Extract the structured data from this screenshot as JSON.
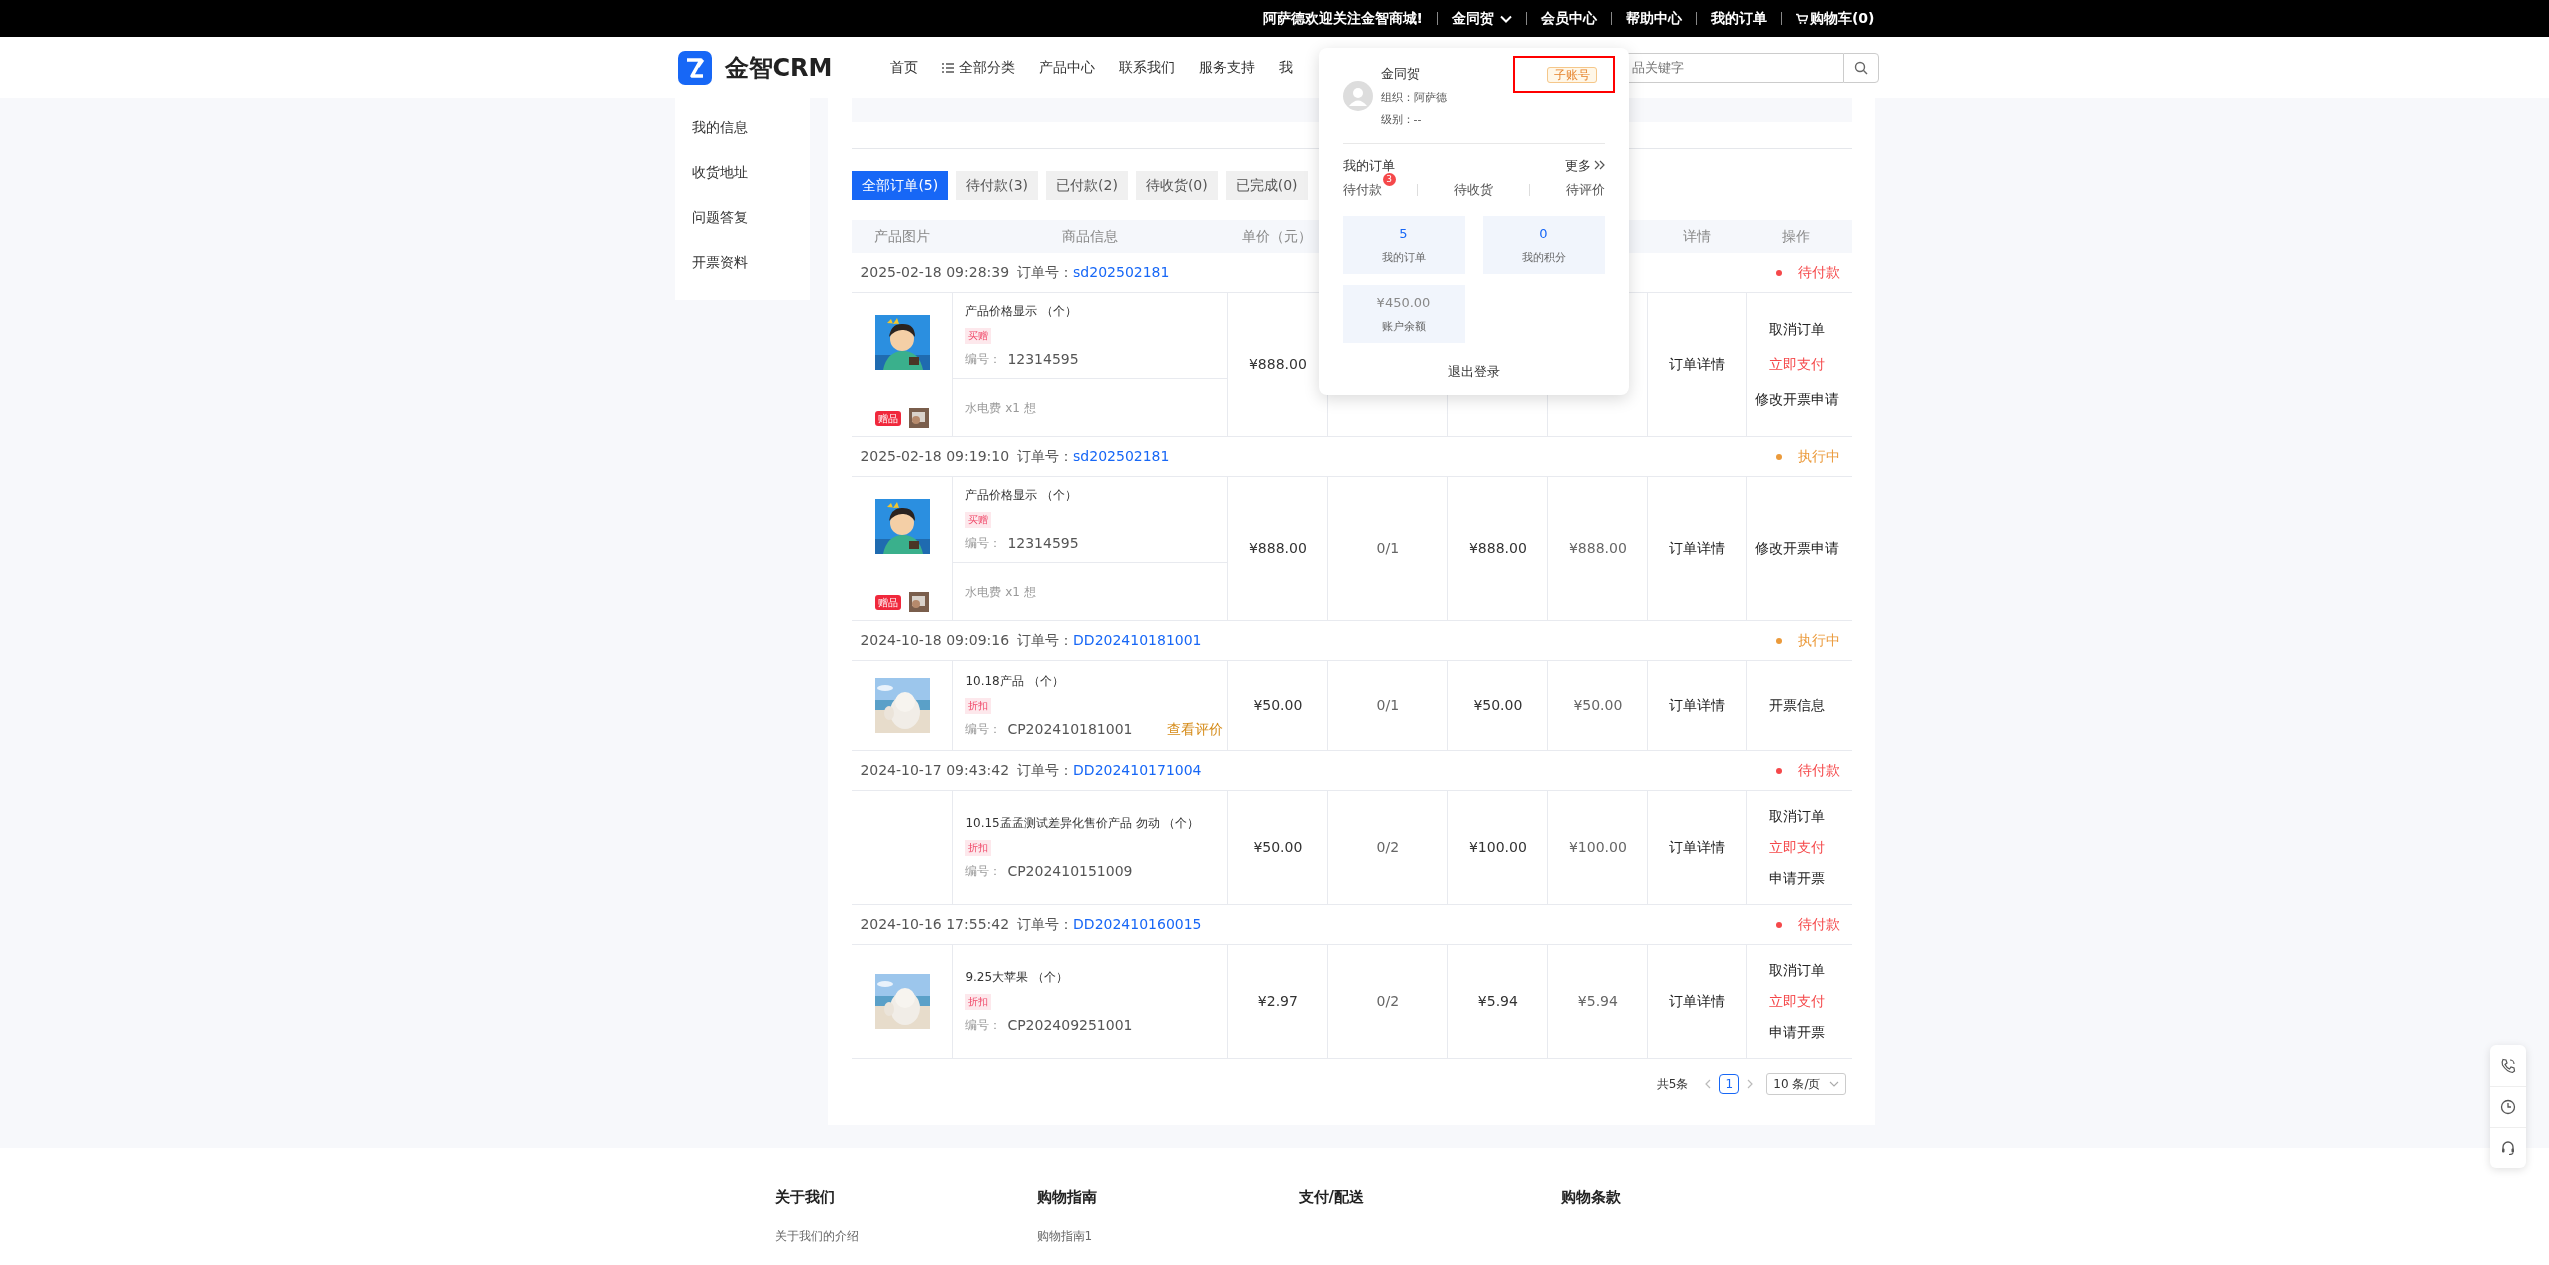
{
  "topbar": {
    "welcome": "阿萨德欢迎关注金智商城!",
    "links": [
      {
        "label": "金同贺",
        "kind": "dropdown"
      },
      {
        "label": "会员中心",
        "kind": "link"
      },
      {
        "label": "帮助中心",
        "kind": "link"
      },
      {
        "label": "我的订单",
        "kind": "link"
      },
      {
        "label": "购物车(0)",
        "kind": "cart"
      }
    ]
  },
  "header": {
    "logo": "金智CRM",
    "nav": [
      {
        "label": "首页",
        "kind": "link"
      },
      {
        "label": "全部分类",
        "kind": "menu"
      },
      {
        "label": "产品中心",
        "kind": "link"
      },
      {
        "label": "联系我们",
        "kind": "link"
      },
      {
        "label": "服务支持",
        "kind": "link"
      },
      {
        "label": "我",
        "kind": "link"
      }
    ],
    "search": {
      "placeholder": "品关键字"
    }
  },
  "user_menu": {
    "name": "金同贺",
    "org": "组织：阿萨德",
    "level": "级别：--",
    "account_tag": "子账号",
    "highlighted": true,
    "orders_title": "我的订单",
    "more": "更多",
    "order_states": [
      {
        "label": "待付款",
        "badge": "3"
      },
      {
        "label": "待收货"
      },
      {
        "label": "待评价"
      }
    ],
    "stats": [
      {
        "value": "5",
        "label": "我的订单",
        "kind": "link"
      },
      {
        "value": "0",
        "label": "我的积分",
        "kind": "link"
      },
      {
        "value": "¥450.00",
        "label": "账户余额",
        "kind": "muted"
      }
    ],
    "logout": "退出登录"
  },
  "sidebar": {
    "items": [
      "我的信息",
      "收货地址",
      "问题答复",
      "开票资料"
    ]
  },
  "tabs": [
    {
      "label": "全部订单(5)",
      "selected": true
    },
    {
      "label": "待付款(3)",
      "selected": false
    },
    {
      "label": "已付款(2)",
      "selected": false
    },
    {
      "label": "待收货(0)",
      "selected": false
    },
    {
      "label": "已完成(0)",
      "selected": false
    }
  ],
  "table": {
    "columns_left": [
      "产品图片",
      "商品信息",
      "单价（元）"
    ],
    "columns_right": [
      "详情",
      "操作"
    ],
    "orders": [
      {
        "time": "2025-02-18 09:28:39",
        "no_label": "订单号：",
        "no": "sd202502181",
        "status": "待付款",
        "color": "#f5484a",
        "has_image": true,
        "name": "产品价格显示 （个）",
        "tag": "买赠",
        "code_label": "编号：",
        "code": "12314595",
        "gift": {
          "badge": "赠品",
          "text": "水电费 x1 想"
        },
        "unit_price": "¥888.00",
        "detail": "订单详情",
        "actions": [
          {
            "label": "取消订单",
            "kind": "normal"
          },
          {
            "label": "立即支付",
            "kind": "danger"
          },
          {
            "label": "修改开票申请",
            "kind": "normal"
          }
        ]
      },
      {
        "time": "2025-02-18 09:19:10",
        "no_label": "订单号：",
        "no": "sd202502181",
        "status": "执行中",
        "color": "#eb9a3b",
        "has_image": true,
        "name": "产品价格显示 （个）",
        "tag": "买赠",
        "code_label": "编号：",
        "code": "12314595",
        "gift": {
          "badge": "赠品",
          "text": "水电费 x1 想"
        },
        "unit_price": "¥888.00",
        "qty": "0/1",
        "amount": "¥888.00",
        "paid": "¥888.00",
        "detail": "订单详情",
        "actions": [
          {
            "label": "修改开票申请",
            "kind": "normal"
          }
        ]
      },
      {
        "time": "2024-10-18 09:09:16",
        "no_label": "订单号：",
        "no": "DD202410181001",
        "status": "执行中",
        "color": "#eb9a3b",
        "has_image": true,
        "name": "10.18产品 （个）",
        "tag": "折扣",
        "code_label": "编号：",
        "code": "CP202410181001",
        "review": "查看评价",
        "unit_price": "¥50.00",
        "qty": "0/1",
        "amount": "¥50.00",
        "paid": "¥50.00",
        "detail": "订单详情",
        "actions": [
          {
            "label": "开票信息",
            "kind": "normal"
          }
        ]
      },
      {
        "time": "2024-10-17 09:43:42",
        "no_label": "订单号：",
        "no": "DD202410171004",
        "status": "待付款",
        "color": "#f5484a",
        "has_image": false,
        "name": "10.15孟孟测试差异化售价产品 勿动 （个）",
        "tag": "折扣",
        "code_label": "编号：",
        "code": "CP202410151009",
        "unit_price": "¥50.00",
        "qty": "0/2",
        "amount": "¥100.00",
        "paid": "¥100.00",
        "detail": "订单详情",
        "actions": [
          {
            "label": "取消订单",
            "kind": "normal"
          },
          {
            "label": "立即支付",
            "kind": "danger"
          },
          {
            "label": "申请开票",
            "kind": "normal"
          }
        ]
      },
      {
        "time": "2024-10-16 17:55:42",
        "no_label": "订单号：",
        "no": "DD202410160015",
        "status": "待付款",
        "color": "#f5484a",
        "has_image": true,
        "name": "9.25大苹果 （个）",
        "tag": "折扣",
        "code_label": "编号：",
        "code": "CP202409251001",
        "unit_price": "¥2.97",
        "qty": "0/2",
        "amount": "¥5.94",
        "paid": "¥5.94",
        "detail": "订单详情",
        "actions": [
          {
            "label": "取消订单",
            "kind": "normal"
          },
          {
            "label": "立即支付",
            "kind": "danger"
          },
          {
            "label": "申请开票",
            "kind": "normal"
          }
        ]
      }
    ]
  },
  "pagination": {
    "total": "共5条",
    "pages": [
      {
        "label": "1",
        "selected": true
      }
    ],
    "page_size": "10 条/页"
  },
  "footer": {
    "columns": [
      {
        "title": "关于我们",
        "links": [
          "关于我们的介绍"
        ]
      },
      {
        "title": "购物指南",
        "links": [
          "购物指南1"
        ]
      },
      {
        "title": "支付/配送"
      },
      {
        "title": "购物条款"
      }
    ]
  }
}
